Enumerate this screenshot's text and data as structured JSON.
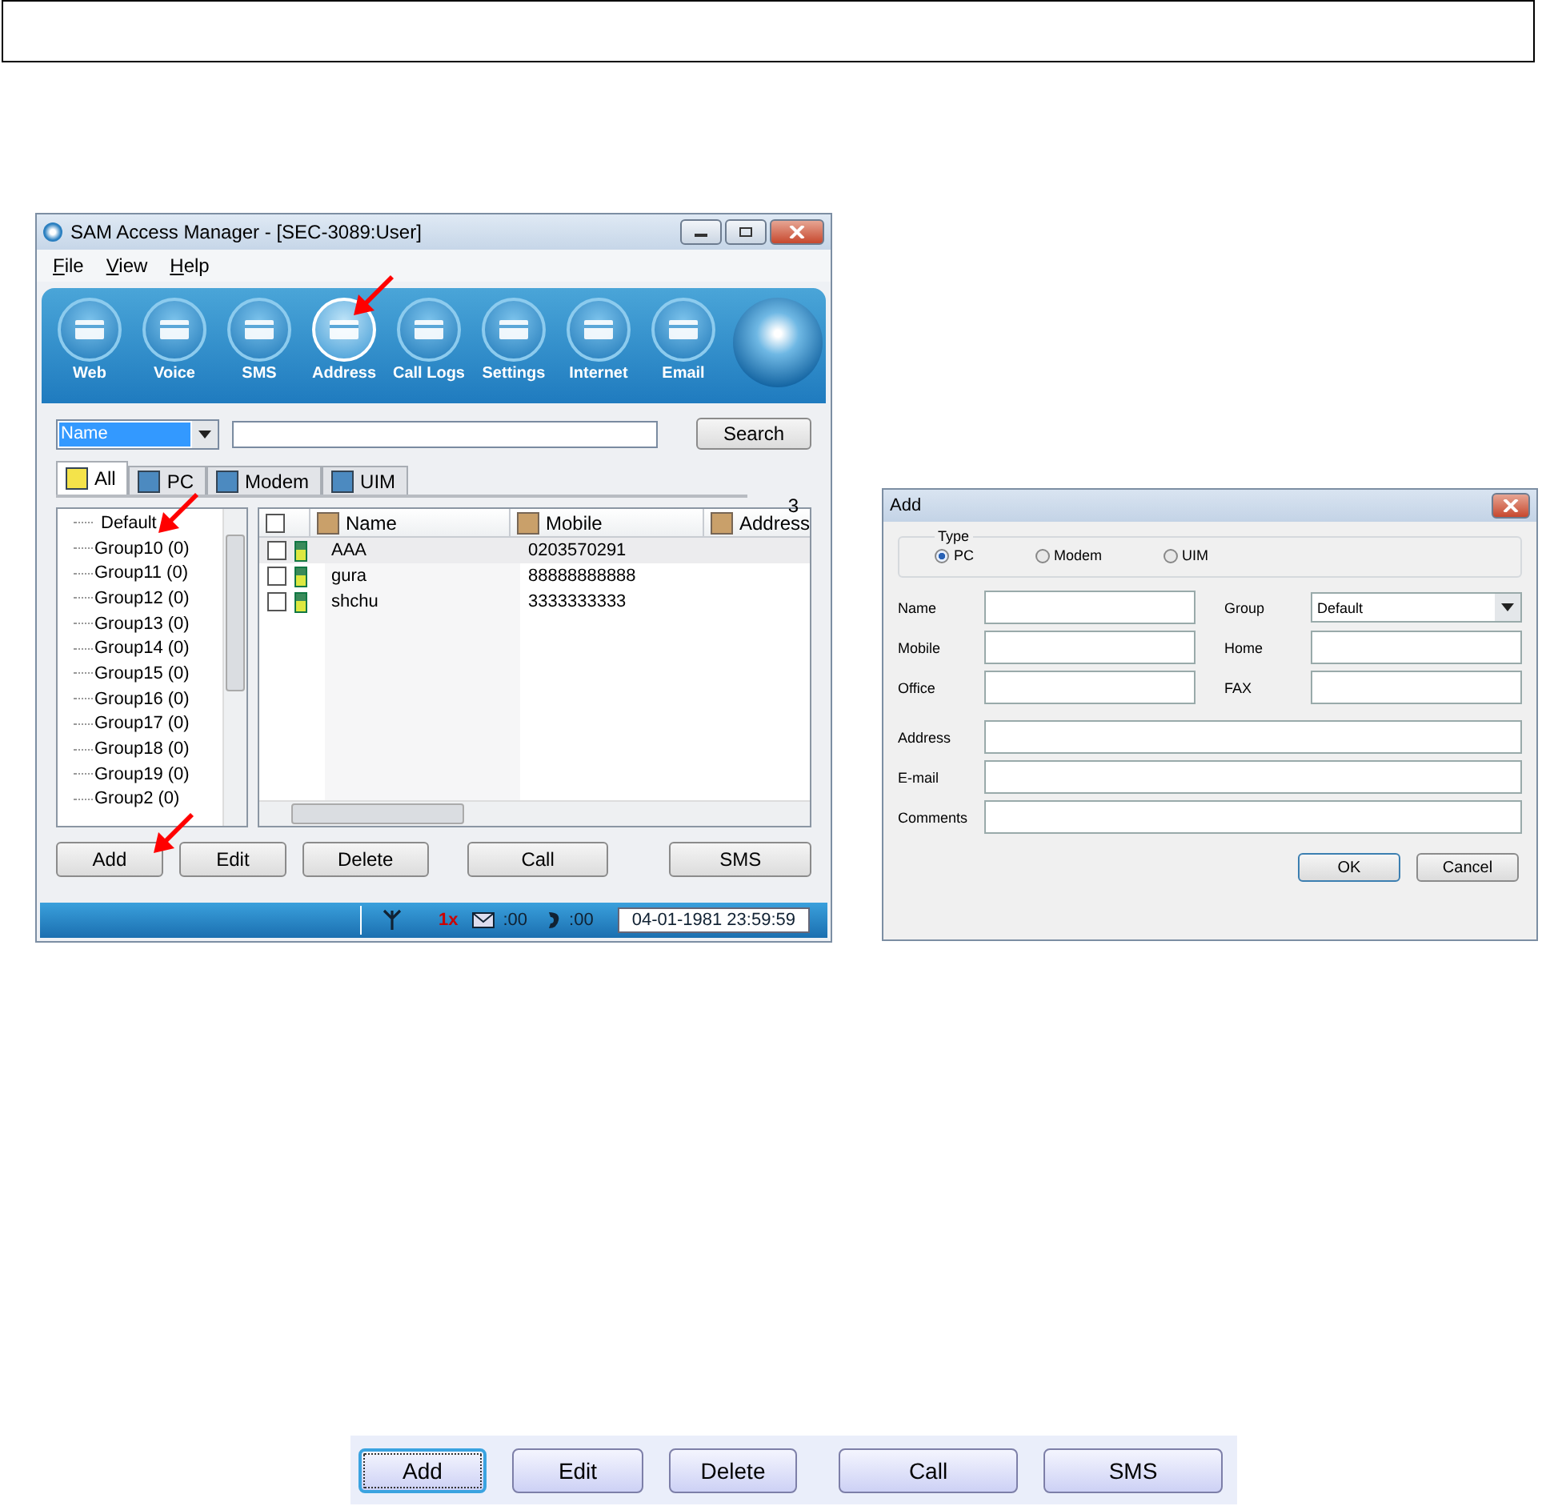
{
  "main_window": {
    "title": "SAM Access Manager - [SEC-3089:User]",
    "menu": [
      "File",
      "View",
      "Help"
    ],
    "toolbar": [
      {
        "label": "Web",
        "selected": false
      },
      {
        "label": "Voice",
        "selected": false
      },
      {
        "label": "SMS",
        "selected": false
      },
      {
        "label": "Address",
        "selected": true
      },
      {
        "label": "Call Logs",
        "selected": false
      },
      {
        "label": "Settings",
        "selected": false
      },
      {
        "label": "Internet",
        "selected": false
      },
      {
        "label": "Email",
        "selected": false
      }
    ],
    "search": {
      "field": "Name",
      "button": "Search"
    },
    "tabs": [
      {
        "label": "All",
        "selected": true
      },
      {
        "label": "PC",
        "selected": false
      },
      {
        "label": "Modem",
        "selected": false
      },
      {
        "label": "UIM",
        "selected": false
      }
    ],
    "count": "3",
    "groups": [
      "Default",
      "Group10 (0)",
      "Group11 (0)",
      "Group12 (0)",
      "Group13 (0)",
      "Group14 (0)",
      "Group15 (0)",
      "Group16 (0)",
      "Group17 (0)",
      "Group18 (0)",
      "Group19 (0)",
      "Group2 (0)"
    ],
    "table": {
      "select_all_checked": false,
      "columns": [
        "Name",
        "Mobile",
        "Address"
      ],
      "rows": [
        {
          "checked": false,
          "selected": true,
          "name": "AAA",
          "mobile": "0203570291"
        },
        {
          "checked": false,
          "selected": false,
          "name": "gura",
          "mobile": "88888888888"
        },
        {
          "checked": false,
          "selected": false,
          "name": "shchu",
          "mobile": "3333333333"
        }
      ]
    },
    "buttons": [
      "Add",
      "Edit",
      "Delete",
      "Call",
      "SMS"
    ],
    "status_bar": {
      "network": "1x",
      "messages": ":00",
      "calls": ":00",
      "datetime": "04-01-1981 23:59:59"
    }
  },
  "add_dialog": {
    "title": "Add",
    "type_label": "Type",
    "types": [
      {
        "label": "PC",
        "selected": true
      },
      {
        "label": "Modem",
        "selected": false
      },
      {
        "label": "UIM",
        "selected": false
      }
    ],
    "fields": [
      {
        "label": "Name",
        "kind": "text"
      },
      {
        "label": "Group",
        "kind": "select",
        "value": "Default"
      },
      {
        "label": "Mobile",
        "kind": "text"
      },
      {
        "label": "Home",
        "kind": "text"
      },
      {
        "label": "Office",
        "kind": "text"
      },
      {
        "label": "FAX",
        "kind": "text"
      },
      {
        "label": "Address",
        "kind": "wide"
      },
      {
        "label": "E-mail",
        "kind": "wide"
      },
      {
        "label": "Comments",
        "kind": "wide"
      }
    ],
    "buttons": [
      "OK",
      "Cancel"
    ]
  },
  "button_bar": [
    {
      "label": "Add",
      "focused": true
    },
    {
      "label": "Edit",
      "focused": false
    },
    {
      "label": "Delete",
      "focused": false
    },
    {
      "label": "Call",
      "focused": false
    },
    {
      "label": "SMS",
      "focused": false
    }
  ]
}
